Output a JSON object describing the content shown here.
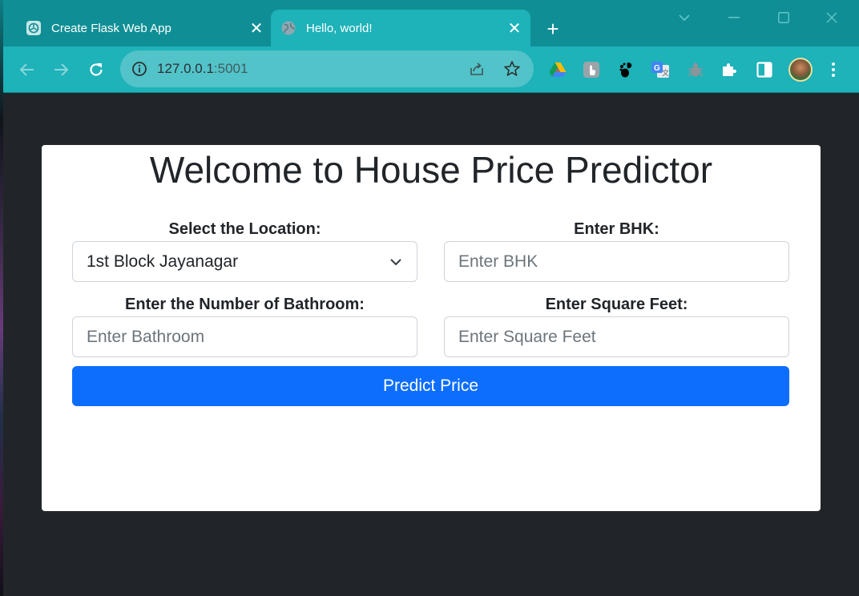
{
  "browser": {
    "tabs": [
      {
        "title": "Create Flask Web App",
        "favicon": "openai-icon",
        "active": false
      },
      {
        "title": "Hello, world!",
        "favicon": "globe-icon",
        "active": true
      }
    ],
    "address": {
      "host": "127.0.0.1",
      "port": ":5001"
    },
    "accent": "#1eb2b9",
    "extensions": [
      "google-drive-icon",
      "touch-icon",
      "gnome-icon",
      "google-translate-icon",
      "bug-icon",
      "puzzle-icon",
      "sidepanel-icon"
    ]
  },
  "page": {
    "title": "Welcome to House Price Predictor",
    "location": {
      "label": "Select the Location:",
      "selected": "1st Block Jayanagar"
    },
    "bhk": {
      "label": "Enter BHK:",
      "placeholder": "Enter BHK"
    },
    "bathroom": {
      "label": "Enter the Number of Bathroom:",
      "placeholder": "Enter Bathroom"
    },
    "sqft": {
      "label": "Enter Square Feet:",
      "placeholder": "Enter Square Feet"
    },
    "predict_label": "Predict Price",
    "button_color": "#0d6efd"
  }
}
